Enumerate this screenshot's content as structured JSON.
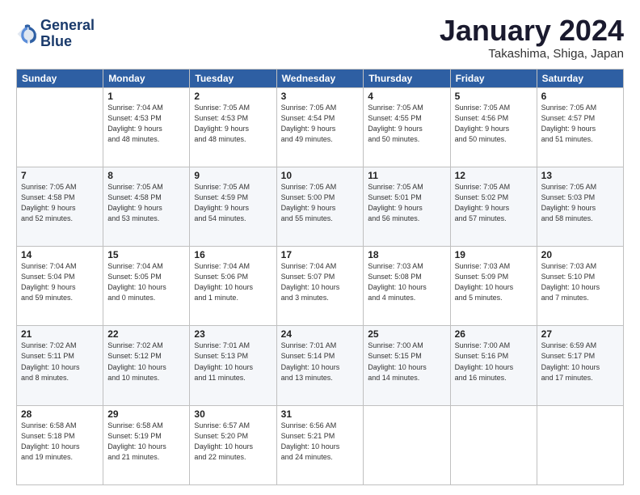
{
  "logo": {
    "line1": "General",
    "line2": "Blue"
  },
  "title": "January 2024",
  "location": "Takashima, Shiga, Japan",
  "header_days": [
    "Sunday",
    "Monday",
    "Tuesday",
    "Wednesday",
    "Thursday",
    "Friday",
    "Saturday"
  ],
  "weeks": [
    [
      {
        "day": "",
        "info": ""
      },
      {
        "day": "1",
        "info": "Sunrise: 7:04 AM\nSunset: 4:53 PM\nDaylight: 9 hours\nand 48 minutes."
      },
      {
        "day": "2",
        "info": "Sunrise: 7:05 AM\nSunset: 4:53 PM\nDaylight: 9 hours\nand 48 minutes."
      },
      {
        "day": "3",
        "info": "Sunrise: 7:05 AM\nSunset: 4:54 PM\nDaylight: 9 hours\nand 49 minutes."
      },
      {
        "day": "4",
        "info": "Sunrise: 7:05 AM\nSunset: 4:55 PM\nDaylight: 9 hours\nand 50 minutes."
      },
      {
        "day": "5",
        "info": "Sunrise: 7:05 AM\nSunset: 4:56 PM\nDaylight: 9 hours\nand 50 minutes."
      },
      {
        "day": "6",
        "info": "Sunrise: 7:05 AM\nSunset: 4:57 PM\nDaylight: 9 hours\nand 51 minutes."
      }
    ],
    [
      {
        "day": "7",
        "info": "Sunrise: 7:05 AM\nSunset: 4:58 PM\nDaylight: 9 hours\nand 52 minutes."
      },
      {
        "day": "8",
        "info": "Sunrise: 7:05 AM\nSunset: 4:58 PM\nDaylight: 9 hours\nand 53 minutes."
      },
      {
        "day": "9",
        "info": "Sunrise: 7:05 AM\nSunset: 4:59 PM\nDaylight: 9 hours\nand 54 minutes."
      },
      {
        "day": "10",
        "info": "Sunrise: 7:05 AM\nSunset: 5:00 PM\nDaylight: 9 hours\nand 55 minutes."
      },
      {
        "day": "11",
        "info": "Sunrise: 7:05 AM\nSunset: 5:01 PM\nDaylight: 9 hours\nand 56 minutes."
      },
      {
        "day": "12",
        "info": "Sunrise: 7:05 AM\nSunset: 5:02 PM\nDaylight: 9 hours\nand 57 minutes."
      },
      {
        "day": "13",
        "info": "Sunrise: 7:05 AM\nSunset: 5:03 PM\nDaylight: 9 hours\nand 58 minutes."
      }
    ],
    [
      {
        "day": "14",
        "info": "Sunrise: 7:04 AM\nSunset: 5:04 PM\nDaylight: 9 hours\nand 59 minutes."
      },
      {
        "day": "15",
        "info": "Sunrise: 7:04 AM\nSunset: 5:05 PM\nDaylight: 10 hours\nand 0 minutes."
      },
      {
        "day": "16",
        "info": "Sunrise: 7:04 AM\nSunset: 5:06 PM\nDaylight: 10 hours\nand 1 minute."
      },
      {
        "day": "17",
        "info": "Sunrise: 7:04 AM\nSunset: 5:07 PM\nDaylight: 10 hours\nand 3 minutes."
      },
      {
        "day": "18",
        "info": "Sunrise: 7:03 AM\nSunset: 5:08 PM\nDaylight: 10 hours\nand 4 minutes."
      },
      {
        "day": "19",
        "info": "Sunrise: 7:03 AM\nSunset: 5:09 PM\nDaylight: 10 hours\nand 5 minutes."
      },
      {
        "day": "20",
        "info": "Sunrise: 7:03 AM\nSunset: 5:10 PM\nDaylight: 10 hours\nand 7 minutes."
      }
    ],
    [
      {
        "day": "21",
        "info": "Sunrise: 7:02 AM\nSunset: 5:11 PM\nDaylight: 10 hours\nand 8 minutes."
      },
      {
        "day": "22",
        "info": "Sunrise: 7:02 AM\nSunset: 5:12 PM\nDaylight: 10 hours\nand 10 minutes."
      },
      {
        "day": "23",
        "info": "Sunrise: 7:01 AM\nSunset: 5:13 PM\nDaylight: 10 hours\nand 11 minutes."
      },
      {
        "day": "24",
        "info": "Sunrise: 7:01 AM\nSunset: 5:14 PM\nDaylight: 10 hours\nand 13 minutes."
      },
      {
        "day": "25",
        "info": "Sunrise: 7:00 AM\nSunset: 5:15 PM\nDaylight: 10 hours\nand 14 minutes."
      },
      {
        "day": "26",
        "info": "Sunrise: 7:00 AM\nSunset: 5:16 PM\nDaylight: 10 hours\nand 16 minutes."
      },
      {
        "day": "27",
        "info": "Sunrise: 6:59 AM\nSunset: 5:17 PM\nDaylight: 10 hours\nand 17 minutes."
      }
    ],
    [
      {
        "day": "28",
        "info": "Sunrise: 6:58 AM\nSunset: 5:18 PM\nDaylight: 10 hours\nand 19 minutes."
      },
      {
        "day": "29",
        "info": "Sunrise: 6:58 AM\nSunset: 5:19 PM\nDaylight: 10 hours\nand 21 minutes."
      },
      {
        "day": "30",
        "info": "Sunrise: 6:57 AM\nSunset: 5:20 PM\nDaylight: 10 hours\nand 22 minutes."
      },
      {
        "day": "31",
        "info": "Sunrise: 6:56 AM\nSunset: 5:21 PM\nDaylight: 10 hours\nand 24 minutes."
      },
      {
        "day": "",
        "info": ""
      },
      {
        "day": "",
        "info": ""
      },
      {
        "day": "",
        "info": ""
      }
    ]
  ]
}
